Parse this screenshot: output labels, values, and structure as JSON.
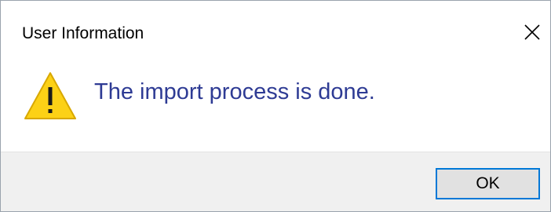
{
  "window": {
    "title": "User Information",
    "close_icon": "close-icon"
  },
  "content": {
    "icon": "warning-icon",
    "message": "The import process is done."
  },
  "footer": {
    "ok_label": "OK"
  },
  "colors": {
    "message_text": "#2e3b94",
    "footer_bg": "#f0f0f0",
    "button_bg": "#e1e1e1",
    "button_border_focus": "#0078d7",
    "warning_fill": "#fcd116",
    "warning_stroke": "#d8a800"
  }
}
